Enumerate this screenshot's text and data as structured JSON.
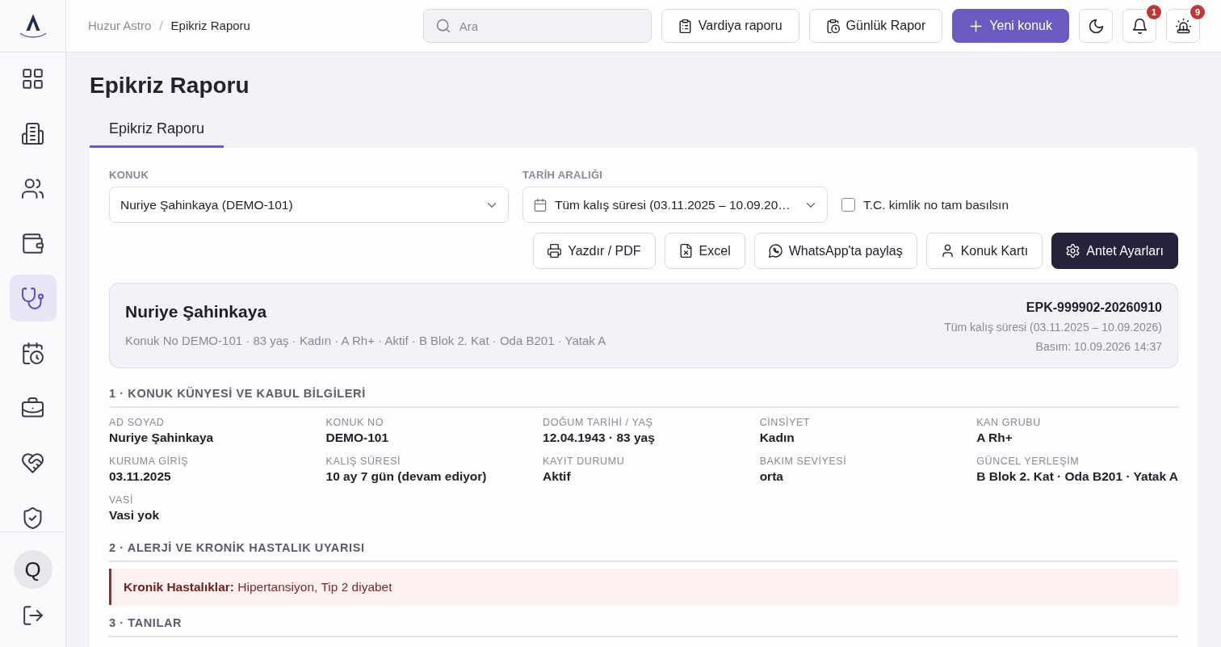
{
  "sidebar": {
    "items": [
      {
        "selected": false
      },
      {
        "selected": false
      },
      {
        "selected": false
      },
      {
        "selected": false
      },
      {
        "selected": true
      },
      {
        "selected": false
      },
      {
        "selected": false
      },
      {
        "selected": false
      },
      {
        "selected": false
      }
    ],
    "avatar": "Q"
  },
  "topbar": {
    "breadcrumb": {
      "items": [
        "Huzur Astro",
        "Epikriz Raporu"
      ],
      "separator": "/"
    },
    "search": {
      "placeholder": "Ara"
    },
    "buttons": [
      {
        "label": "Vardiya raporu",
        "kind": "outline"
      },
      {
        "label": "Günlük Rapor",
        "kind": "outline"
      },
      {
        "label": "Yeni konuk",
        "kind": "primary"
      }
    ],
    "notifications": {
      "badge": "1"
    },
    "alarms": {
      "badge": "9"
    }
  },
  "page": {
    "title": "Epikriz Raporu",
    "tabs": [
      {
        "label": "Epikriz Raporu",
        "selected": true
      }
    ]
  },
  "filters": {
    "guest": {
      "label": "KONUK",
      "value": "Nuriye Şahinkaya (DEMO-101)"
    },
    "date_range": {
      "label": "TARİH ARALIĞI",
      "value": "Tüm kalış süresi (03.11.2025 – 10.09.20…"
    },
    "tc_full": {
      "label": "T.C. kimlik no tam basılsın",
      "checked": false
    }
  },
  "actions": [
    {
      "label": "Yazdır / PDF",
      "kind": "outline"
    },
    {
      "label": "Excel",
      "kind": "outline"
    },
    {
      "label": "WhatsApp'ta paylaş",
      "kind": "outline"
    },
    {
      "label": "Konuk Kartı",
      "kind": "outline"
    },
    {
      "label": "Antet Ayarları",
      "kind": "dark"
    }
  ],
  "patient_card": {
    "name": "Nuriye Şahinkaya",
    "summary": "Konuk No DEMO-101 · 83 yaş · Kadın · A Rh+ · Aktif · B Blok 2. Kat · Oda B201 · Yatak A",
    "code": "EPK-999902-20260910",
    "period": "Tüm kalış süresi (03.11.2025 – 10.09.2026)",
    "printed": "Basım: 10.09.2026 14:37"
  },
  "sections": [
    {
      "title": "1 · KONUK KÜNYESİ VE KABUL BİLGİLERİ",
      "kind": "fields",
      "fields": [
        {
          "label": "AD SOYAD",
          "value": "Nuriye Şahinkaya"
        },
        {
          "label": "KONUK NO",
          "value": "DEMO-101"
        },
        {
          "label": "DOĞUM TARİHİ / YAŞ",
          "value": "12.04.1943 · 83 yaş"
        },
        {
          "label": "CİNSİYET",
          "value": "Kadın"
        },
        {
          "label": "KAN GRUBU",
          "value": "A Rh+"
        },
        {
          "label": "KURUMA GİRİŞ",
          "value": "03.11.2025"
        },
        {
          "label": "KALIŞ SÜRESİ",
          "value": "10 ay 7 gün (devam ediyor)"
        },
        {
          "label": "KAYIT DURUMU",
          "value": "Aktif"
        },
        {
          "label": "BAKIM SEVİYESİ",
          "value": "orta"
        },
        {
          "label": "GÜNCEL YERLEŞİM",
          "value": "B Blok 2. Kat · Oda B201 · Yatak A"
        },
        {
          "label": "VASİ",
          "value": "Vasi yok"
        }
      ]
    },
    {
      "title": "2 · ALERJİ VE KRONİK HASTALIK UYARISI",
      "kind": "alert",
      "text": "**Kronik Hastalıklar:** Hipertansiyon, Tip 2 diyabet"
    },
    {
      "title": "3 · TANILAR",
      "kind": "heading"
    }
  ]
}
